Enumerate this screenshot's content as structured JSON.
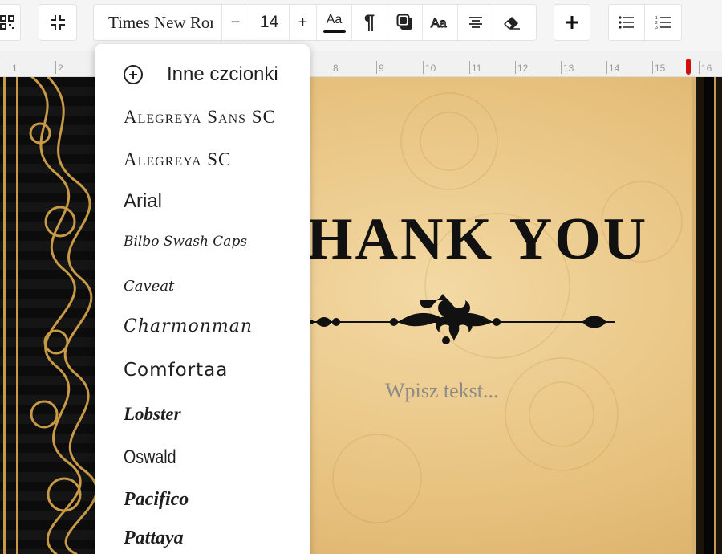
{
  "toolbar": {
    "qr_icon": "qr-code-icon",
    "collapse_icon": "collapse-icon",
    "font_family": "Times New Roman",
    "decrease_label": "−",
    "font_size": "14",
    "increase_label": "+",
    "text_style_label": "Aa",
    "paragraph_icon": "pilcrow-icon",
    "shadow_icon": "text-shadow-icon",
    "outline_icon": "text-outline-icon",
    "align_icon": "align-center-icon",
    "eraser_icon": "eraser-icon",
    "add_icon": "plus-icon",
    "bullet_list_icon": "bullet-list-icon",
    "numbered_list_icon": "numbered-list-icon"
  },
  "ruler": {
    "ticks": [
      "1",
      "2",
      "8",
      "9",
      "10",
      "11",
      "12",
      "13",
      "14",
      "15",
      "16"
    ],
    "marker_color": "#d01010"
  },
  "font_menu": {
    "more_fonts": "Inne czcionki",
    "fonts": [
      "Alegreya Sans SC",
      "Alegreya SC",
      "Arial",
      "Bilbo Swash Caps",
      "Caveat",
      "Charmonman",
      "Comfortaa",
      "Lobster",
      "Oswald",
      "Pacifico",
      "Pattaya"
    ]
  },
  "card": {
    "headline": "HANK YOU",
    "placeholder": "Wpisz tekst...",
    "gold": "#e7c27f",
    "dark": "#111111"
  }
}
